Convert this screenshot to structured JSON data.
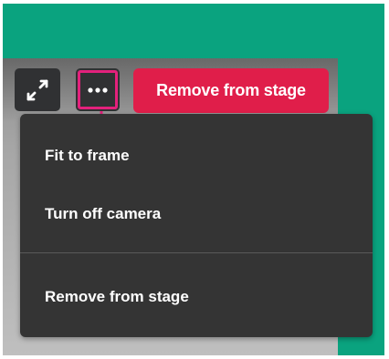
{
  "controls": {
    "fullscreen_icon": "expand-arrows-icon",
    "more_icon": "ellipsis-icon",
    "remove_label": "Remove from stage"
  },
  "menu": {
    "items": [
      {
        "label": "Fit to frame"
      },
      {
        "label": "Turn off camera"
      },
      {
        "label": "Remove from stage"
      }
    ]
  },
  "colors": {
    "stage_background": "#0aa37f",
    "remove_button": "#e01e4a",
    "highlight": "#e3217c",
    "menu_background": "#343434",
    "control_background": "#303133"
  }
}
